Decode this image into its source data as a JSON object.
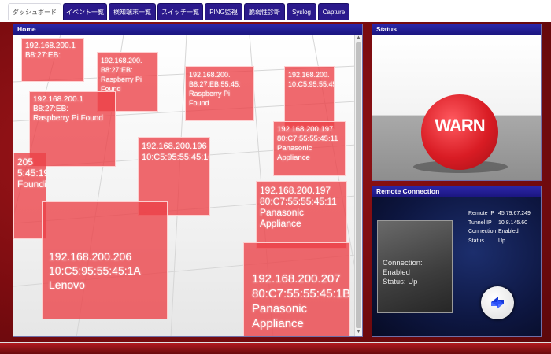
{
  "tabs": [
    {
      "label": "ダッシュボード",
      "active": true
    },
    {
      "label": "イベント一覧",
      "active": false
    },
    {
      "label": "検知端末一覧",
      "active": false
    },
    {
      "label": "スイッチ一覧",
      "active": false
    },
    {
      "label": "PING監視",
      "active": false
    },
    {
      "label": "脆弱性診断",
      "active": false
    },
    {
      "label": "Syslog",
      "active": false
    },
    {
      "label": "Capture",
      "active": false
    }
  ],
  "home": {
    "title": "Home",
    "devices": [
      {
        "ip": "192.168.200.1",
        "mac": "B8:27:EB:",
        "vendor": ""
      },
      {
        "ip": "192.168.200.1",
        "mac": "B8:27:EB:",
        "vendor": "Raspberry Pi Found"
      },
      {
        "ip": "192.168.200.",
        "mac": "B8:27:EB:55:45:",
        "vendor": ""
      },
      {
        "ip": "192.168.200.",
        "mac": "B8:27:EB:55:45:",
        "vendor": "Raspberry Pi Found"
      },
      {
        "ip": "192.168.200.",
        "mac": "B8:27:EB:",
        "vendor": ""
      },
      {
        "ip": "192.168.200.",
        "mac": "B8:27:EB:",
        "vendor": "Raspberry Pi Found"
      },
      {
        "ip": "192.168.200.",
        "mac": "10:C5:95:55:45:",
        "vendor": ""
      },
      {
        "ip": "192.168.200.197",
        "mac": "80:C7:55:55:45:11",
        "vendor": "Panasonic Appliance"
      },
      {
        "ip": "192.168.200.196",
        "mac": "10:C5:95:55:45:10",
        "vendor": ""
      },
      {
        "ip": "205",
        "mac": "5:45:19",
        "vendor": "Foundi"
      },
      {
        "ip": "192.168.200.197",
        "mac": "80:C7:55:55:45:11",
        "vendor": "Panasonic Appliance"
      },
      {
        "ip": "192.168.200.206",
        "mac": "10:C5:95:55:45:1A",
        "vendor": "Lenovo"
      },
      {
        "ip": "192.168.200.207",
        "mac": "80:C7:55:55:45:1B",
        "vendor": "Panasonic Appliance"
      }
    ]
  },
  "status": {
    "title": "Status",
    "label": "WARN"
  },
  "remote": {
    "title": "Remote Connection",
    "cube_text_1": "Connection: Enabled",
    "cube_text_2": "Status: Up",
    "info": [
      {
        "key": "Remote IP",
        "value": "45.79.67.249"
      },
      {
        "key": "Tunnel IP",
        "value": "10.8.145.60"
      },
      {
        "key": "Connection",
        "value": "Enabled"
      },
      {
        "key": "Status",
        "value": "Up"
      }
    ],
    "button_icon": "swap-arrows-icon"
  },
  "colors": {
    "accent": "#2b1a8c",
    "box": "#ec4046",
    "warn": "#d91c24",
    "remote_bg": "#0d1640"
  }
}
